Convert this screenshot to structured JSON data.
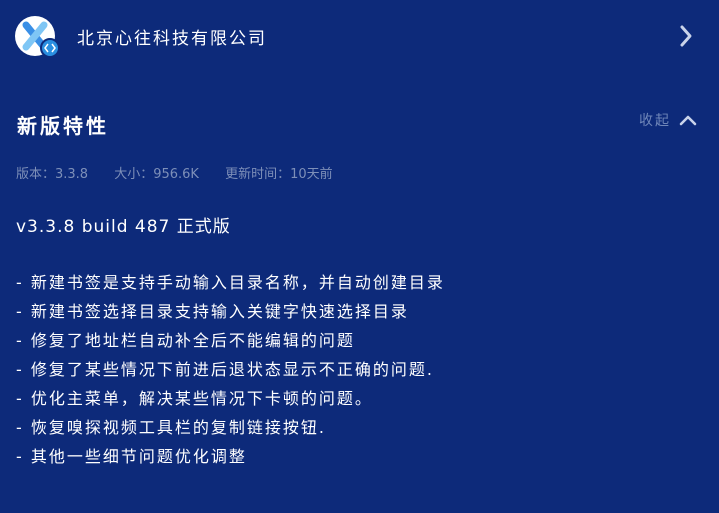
{
  "developer": {
    "name": "北京心往科技有限公司",
    "icon": "app-x-logo-icon",
    "badge_icon": "code-brackets-icon"
  },
  "section": {
    "title": "新版特性",
    "collapse_label": "收起",
    "collapse_icon": "chevron-up-icon"
  },
  "meta": {
    "version": "版本：3.3.8",
    "size": "大小：956.6K",
    "updated": "更新时间：10天前"
  },
  "release": {
    "title": "v3.3.8 build 487 正式版",
    "notes": [
      "- 新建书签是支持手动输入目录名称，并自动创建目录",
      "- 新建书签选择目录支持输入关键字快速选择目录",
      "- 修复了地址栏自动补全后不能编辑的问题",
      "- 修复了某些情况下前进后退状态显示不正确的问题.",
      "- 优化主菜单，解决某些情况下卡顿的问题。",
      "- 恢复嗅探视频工具栏的复制链接按钮.",
      "- 其他一些细节问题优化调整"
    ]
  },
  "colors": {
    "background": "#0d2a7a",
    "muted_text": "#7d8fb8",
    "accent_badge": "#2a8fe0"
  }
}
